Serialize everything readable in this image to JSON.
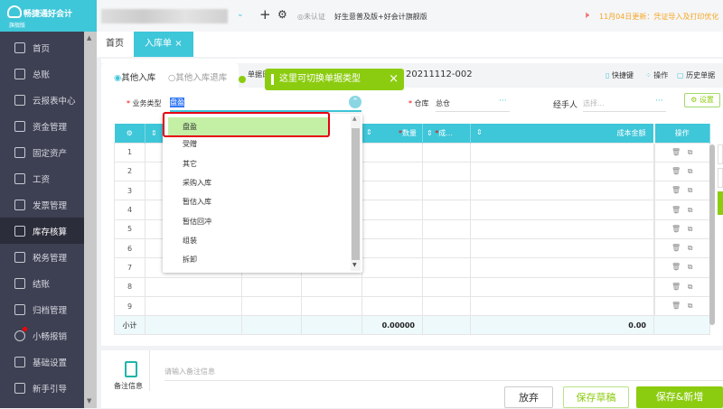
{
  "app": {
    "name": "畅捷通好会计",
    "edition": "旗舰版"
  },
  "topbar": {
    "unverified": "未认证",
    "product": "好生意普及版+好会计旗舰版",
    "notice": "11月04日更新：凭证导入及打印优化"
  },
  "sidebar": {
    "items": [
      {
        "label": "首页"
      },
      {
        "label": "总账"
      },
      {
        "label": "云报表中心"
      },
      {
        "label": "资金管理"
      },
      {
        "label": "固定资产"
      },
      {
        "label": "工资"
      },
      {
        "label": "发票管理"
      },
      {
        "label": "库存核算"
      },
      {
        "label": "税务管理"
      },
      {
        "label": "结账"
      },
      {
        "label": "归档管理"
      },
      {
        "label": "小畅报销"
      },
      {
        "label": "基础设置"
      },
      {
        "label": "新手引导"
      }
    ],
    "active": "库存核算"
  },
  "tabs": [
    {
      "label": "首页"
    },
    {
      "label": "入库单"
    }
  ],
  "form": {
    "radio1": "其他入库",
    "radio2": "其他入库退库",
    "doc_label": "单据日",
    "doc_no": "20211112-002",
    "shortcut": "快捷键",
    "operate": "操作",
    "history": "历史单据",
    "biz_type_label": "业务类型",
    "biz_type_value": "盘盈",
    "warehouse_label": "仓库",
    "warehouse_value": "总仓",
    "handler_label": "经手人",
    "handler_placeholder": "选择...",
    "settings": "设置",
    "more": "···"
  },
  "tip": {
    "text": "这里可切换单据类型",
    "close": "×"
  },
  "dropdown": {
    "options": [
      "盘盈",
      "受赠",
      "其它",
      "采购入库",
      "暂估入库",
      "暂估回冲",
      "组装",
      "拆卸"
    ]
  },
  "table": {
    "headers": {
      "qty": "数量",
      "cost": "成...",
      "amount": "成本金额",
      "ops": "操作"
    },
    "rows": [
      "1",
      "2",
      "3",
      "4",
      "5",
      "6",
      "7",
      "8",
      "9"
    ],
    "subtotal": {
      "label": "小计",
      "qty": "0.00000",
      "amount": "0.00"
    }
  },
  "notes": {
    "label": "备注信息",
    "placeholder": "请输入备注信息"
  },
  "buttons": {
    "discard": "放弃",
    "draft": "保存草稿",
    "save_new": "保存&新增"
  }
}
